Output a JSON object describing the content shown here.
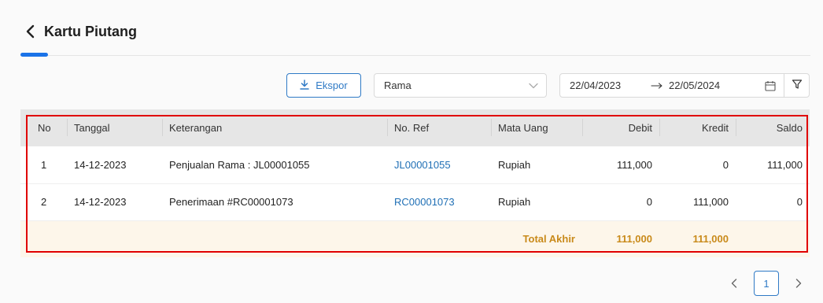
{
  "header": {
    "title": "Kartu Piutang"
  },
  "toolbar": {
    "export_label": "Ekspor",
    "customer_value": "Rama",
    "date_from": "22/04/2023",
    "date_to": "22/05/2024"
  },
  "table": {
    "columns": [
      "No",
      "Tanggal",
      "Keterangan",
      "No. Ref",
      "Mata Uang",
      "Debit",
      "Kredit",
      "Saldo"
    ],
    "rows": [
      {
        "no": "1",
        "tanggal": "14-12-2023",
        "keterangan": "Penjualan Rama : JL00001055",
        "ref": "JL00001055",
        "mata_uang": "Rupiah",
        "debit": "111,000",
        "kredit": "0",
        "saldo": "111,000"
      },
      {
        "no": "2",
        "tanggal": "14-12-2023",
        "keterangan": "Penerimaan #RC00001073",
        "ref": "RC00001073",
        "mata_uang": "Rupiah",
        "debit": "0",
        "kredit": "111,000",
        "saldo": "0"
      }
    ],
    "total": {
      "label": "Total Akhir",
      "debit": "111,000",
      "kredit": "111,000"
    }
  },
  "pagination": {
    "current_page": "1"
  },
  "colors": {
    "accent": "#2f7ac6",
    "highlight_border": "#e00000",
    "total_text": "#c98a1a",
    "total_bg": "#fdf6ea"
  }
}
